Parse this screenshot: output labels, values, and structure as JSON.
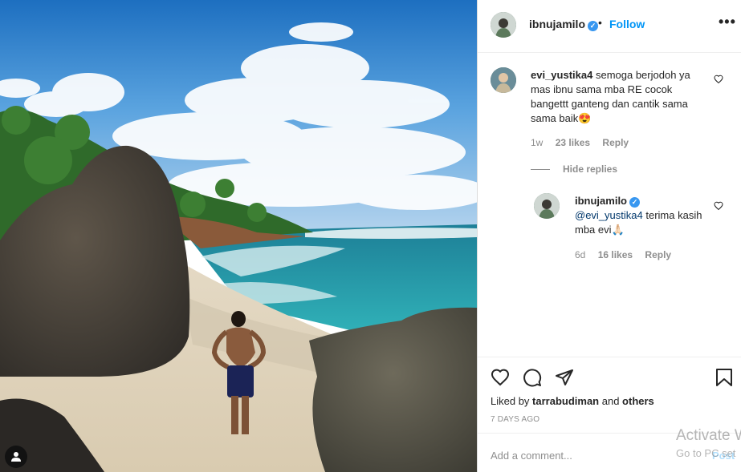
{
  "post": {
    "username": "ibnujamilo",
    "follow_label": "Follow",
    "dot": "•",
    "more": "•••"
  },
  "comment": {
    "username": "evi_yustika4",
    "text": "semoga berjodoh ya mas ibnu sama mba RE cocok bangettt ganteng dan cantik sama sama baik😍",
    "time": "1w",
    "likes": "23 likes",
    "reply_label": "Reply"
  },
  "hide_replies_label": "Hide replies",
  "reply": {
    "username": "ibnujamilo",
    "mention": "@evi_yustika4",
    "text": " terima kasih mba evi🙏🏻",
    "time": "6d",
    "likes": "16 likes",
    "reply_label": "Reply"
  },
  "likes_summary": {
    "prefix": "Liked by ",
    "user": "tarrabudiman",
    "middle": " and ",
    "others": "others"
  },
  "timestamp": "7 DAYS AGO",
  "add_comment": {
    "placeholder": "Add a comment...",
    "post_label": "Post"
  },
  "watermark": {
    "line1": "Activate W",
    "line2": "Go to PC set"
  },
  "icons": {
    "user_tag": "person-icon",
    "like": "heart-icon",
    "comment": "comment-icon",
    "share": "paper-plane-icon",
    "save": "bookmark-icon",
    "verified": "verified-badge-icon"
  },
  "colors": {
    "accent": "#0095f6",
    "verified": "#3897f0",
    "muted": "#8e8e8e",
    "mention": "#00376b",
    "post_disabled": "#b2dffc"
  }
}
